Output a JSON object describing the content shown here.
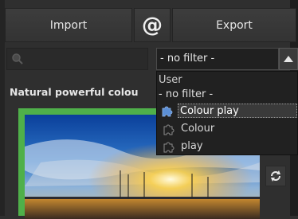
{
  "toolbar": {
    "import_label": "Import",
    "at_label": "@",
    "export_label": "Export"
  },
  "search": {
    "placeholder": ""
  },
  "filter": {
    "selected": "- no filter -",
    "options": [
      {
        "label": "User",
        "type": "group"
      },
      {
        "label": "- no filter -",
        "type": "option"
      },
      {
        "label": "Colour play",
        "type": "option",
        "selected": true,
        "icon": "puzzle-piece-filled-icon"
      },
      {
        "label": "Colour",
        "type": "option",
        "icon": "puzzle-piece-outline-icon"
      },
      {
        "label": "play",
        "type": "option",
        "icon": "puzzle-piece-outline-icon"
      }
    ]
  },
  "preset": {
    "title": "Natural powerful colou"
  },
  "colors": {
    "accent_selection": "#4fb04a",
    "background": "#2f2f2f",
    "dropdown_bg": "#212121",
    "puzzle_selected": "#5b8fd6"
  }
}
